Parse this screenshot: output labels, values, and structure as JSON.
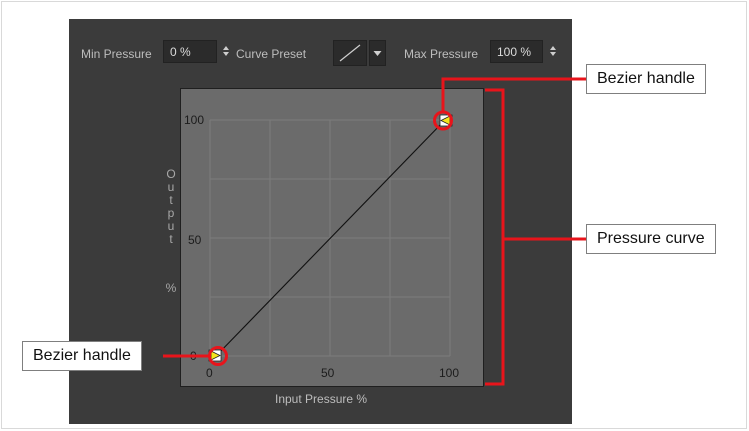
{
  "toolbar": {
    "min_pressure_label": "Min Pressure",
    "min_pressure_value": "0 %",
    "curve_preset_label": "Curve Preset",
    "max_pressure_label": "Max Pressure",
    "max_pressure_value": "100 %"
  },
  "graph": {
    "y_ticks": [
      "100",
      "50",
      "0"
    ],
    "x_ticks": [
      "0",
      "50",
      "100"
    ],
    "y_label_letters": [
      "O",
      "u",
      "t",
      "p",
      "u",
      "t",
      "",
      "%"
    ],
    "x_label": "Input Pressure %"
  },
  "callouts": {
    "top_handle": "Bezier handle",
    "curve": "Pressure curve",
    "bottom_handle": "Bezier handle"
  },
  "icons": {
    "spinner": "spinner-arrows-icon",
    "preset": "linear-curve-icon",
    "dropdown": "chevron-down-icon",
    "handle": "bezier-handle-icon"
  },
  "colors": {
    "accent_red": "#e8141b",
    "panel_bg": "#3b3b3b",
    "graph_bg": "#6b6b6b",
    "handle_yellow": "#f4e51c"
  }
}
